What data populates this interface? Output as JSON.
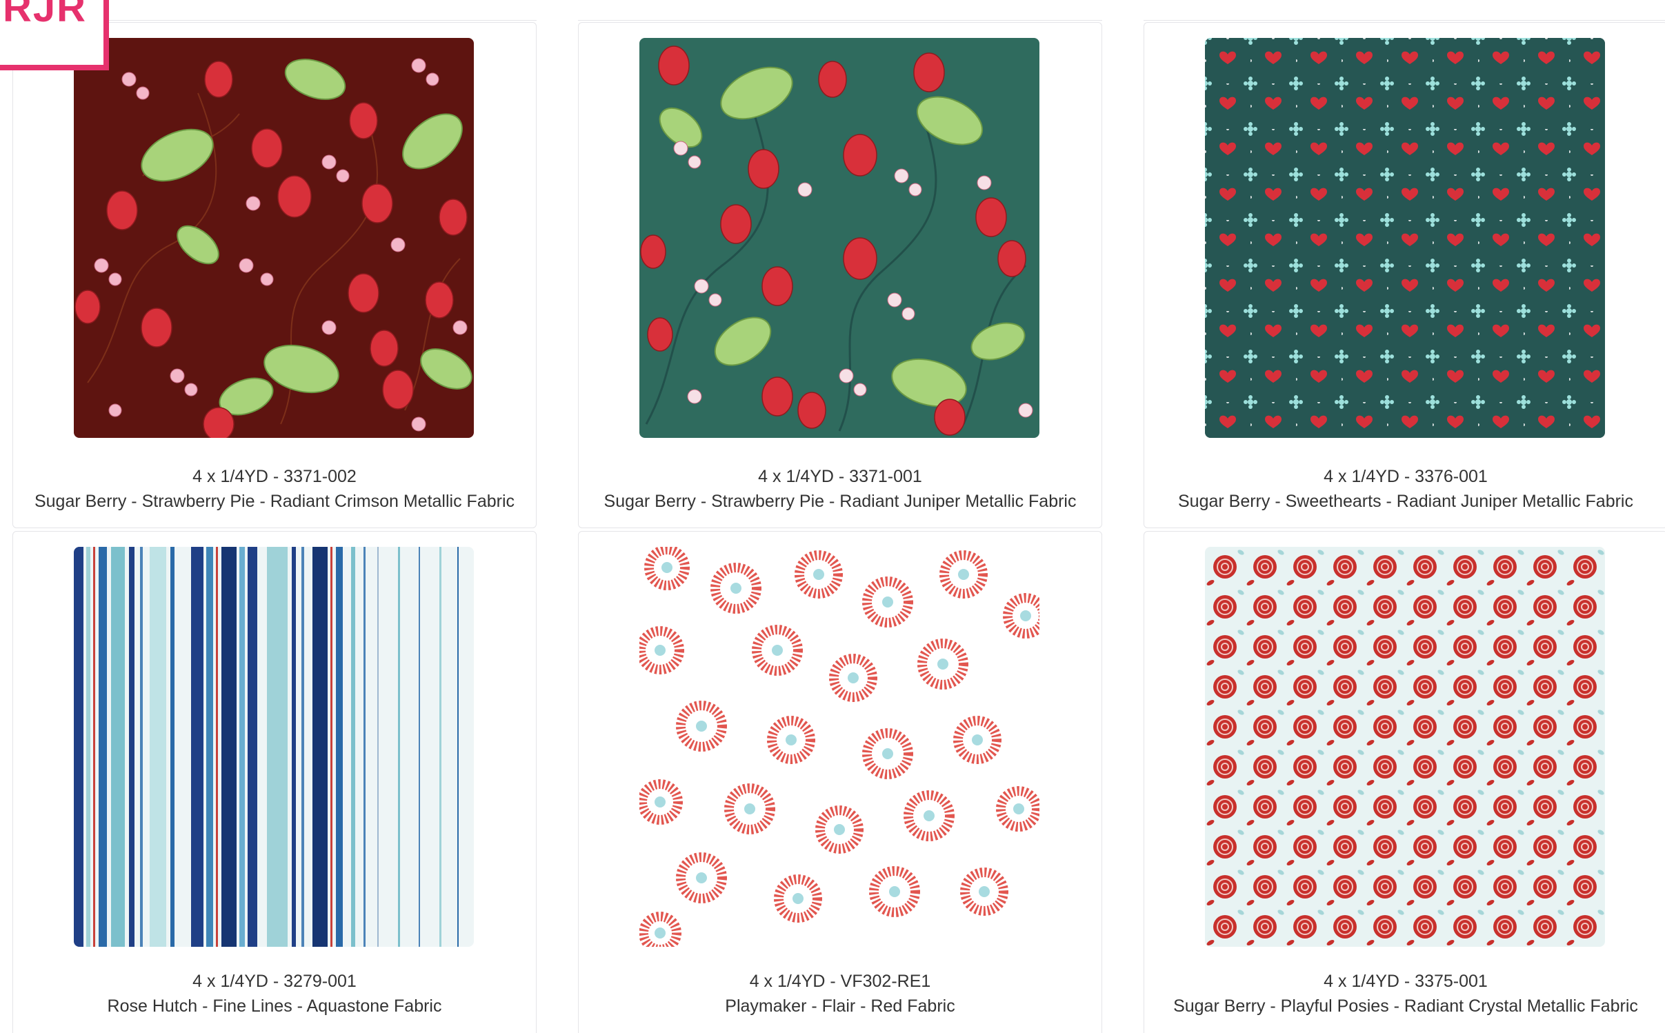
{
  "logo": {
    "text": "RJR"
  },
  "products": [
    {
      "sku": "4 x 1/4YD - 3371-002",
      "name": "Sugar Berry - Strawberry Pie - Radiant Crimson Metallic Fabric"
    },
    {
      "sku": "4 x 1/4YD - 3371-001",
      "name": "Sugar Berry - Strawberry Pie - Radiant Juniper Metallic Fabric"
    },
    {
      "sku": "4 x 1/4YD - 3376-001",
      "name": "Sugar Berry - Sweethearts - Radiant Juniper Metallic Fabric"
    },
    {
      "sku": "4 x 1/4YD - 3279-001",
      "name": "Rose Hutch - Fine Lines - Aquastone Fabric"
    },
    {
      "sku": "4 x 1/4YD - VF302-RE1",
      "name": "Playmaker - Flair - Red Fabric"
    },
    {
      "sku": "4 x 1/4YD - 3375-001",
      "name": "Sugar Berry - Playful Posies - Radiant Crystal Metallic Fabric"
    }
  ],
  "colors": {
    "brand": "#e6316d",
    "crimson": "#5e1410",
    "juniper": "#2f6b5e",
    "juniper_dark": "#1f4a46",
    "berry": "#d8303a",
    "leaf": "#a8d37a"
  }
}
